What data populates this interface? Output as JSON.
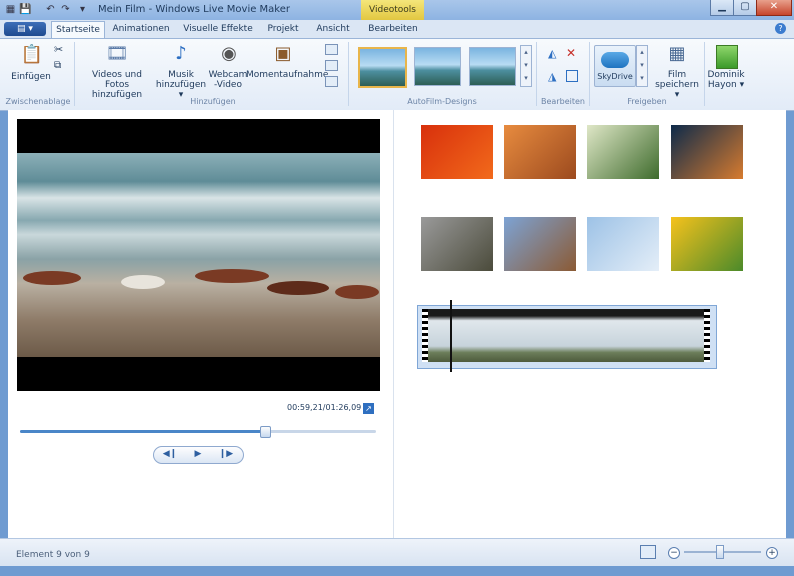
{
  "window": {
    "title": "Mein Film - Windows Live Movie Maker",
    "contextual_tab_group": "Videotools",
    "controls": [
      "▁",
      "▢",
      "✕"
    ],
    "quick_access": [
      "💾",
      "↶",
      "↷",
      "▾"
    ]
  },
  "ribbon_tabs": [
    {
      "label": "Startseite",
      "active": true
    },
    {
      "label": "Animationen",
      "active": false
    },
    {
      "label": "Visuelle Effekte",
      "active": false
    },
    {
      "label": "Projekt",
      "active": false
    },
    {
      "label": "Ansicht",
      "active": false
    },
    {
      "label": "Bearbeiten",
      "active": false
    }
  ],
  "ribbon": {
    "groups": {
      "zwischenablage": {
        "label": "Zwischenablage",
        "paste": {
          "label": "Einfügen",
          "icon": "clipboard-icon"
        },
        "cut_icon": "scissors-icon",
        "copy_icon": "copy-icon"
      },
      "hinzufuegen": {
        "label": "Hinzufügen",
        "videos_fotos": {
          "line1": "Videos und Fotos",
          "line2": "hinzufügen",
          "icon": "film-photo-icon"
        },
        "musik": {
          "line1": "Musik",
          "line2": "hinzufügen ▾",
          "icon": "music-note-icon"
        },
        "webcam": {
          "line1": "Webcam",
          "line2": "-Video",
          "icon": "webcam-icon"
        },
        "momentaufnahme": {
          "line1": "Momentaufnahme",
          "icon": "snapshot-icon"
        }
      },
      "autofilm": {
        "label": "AutoFilm-Designs"
      },
      "bearbeiten": {
        "label": "Bearbeiten"
      },
      "freigeben": {
        "label": "Freigeben",
        "skydrive": {
          "label": "SkyDrive"
        },
        "film_speichern": {
          "line1": "Film",
          "line2": "speichern ▾",
          "icon": "save-movie-icon"
        },
        "user": {
          "line1": "Dominik",
          "line2": "Hayon ▾"
        }
      }
    }
  },
  "preview": {
    "time": "00:59,21/01:26,09",
    "progress_fraction": 0.687
  },
  "playback": {
    "prev": "◀❙",
    "play": "▶",
    "next": "❙▶"
  },
  "status": {
    "text": "Element 9 von 9",
    "zoom_out": "−",
    "zoom_in": "+",
    "zoom_fraction": 0.45
  },
  "storyboard": {
    "photos": [
      {
        "name": "photo-chrysanthemum",
        "colors": [
          "#d8300c",
          "#f26a1b"
        ]
      },
      {
        "name": "photo-desert",
        "colors": [
          "#e78b3f",
          "#9c4a1e"
        ]
      },
      {
        "name": "photo-hydrangea",
        "colors": [
          "#dfe7c7",
          "#3e6b2c"
        ]
      },
      {
        "name": "photo-jellyfish",
        "colors": [
          "#0d2a4a",
          "#d77b2f"
        ]
      },
      {
        "name": "photo-koala",
        "colors": [
          "#9a9a9a",
          "#4b4b3b"
        ]
      },
      {
        "name": "photo-lighthouse",
        "colors": [
          "#7da3d4",
          "#8b5a34"
        ]
      },
      {
        "name": "photo-penguins",
        "colors": [
          "#9dc2e6",
          "#e4eef8"
        ]
      },
      {
        "name": "photo-tulips",
        "colors": [
          "#f6c21c",
          "#4b8a2a"
        ]
      }
    ]
  },
  "colors": {
    "accent": "#3c7ccf",
    "ribbon_bg": "#e2ebf7",
    "window_frame": "#6f9bd1"
  }
}
